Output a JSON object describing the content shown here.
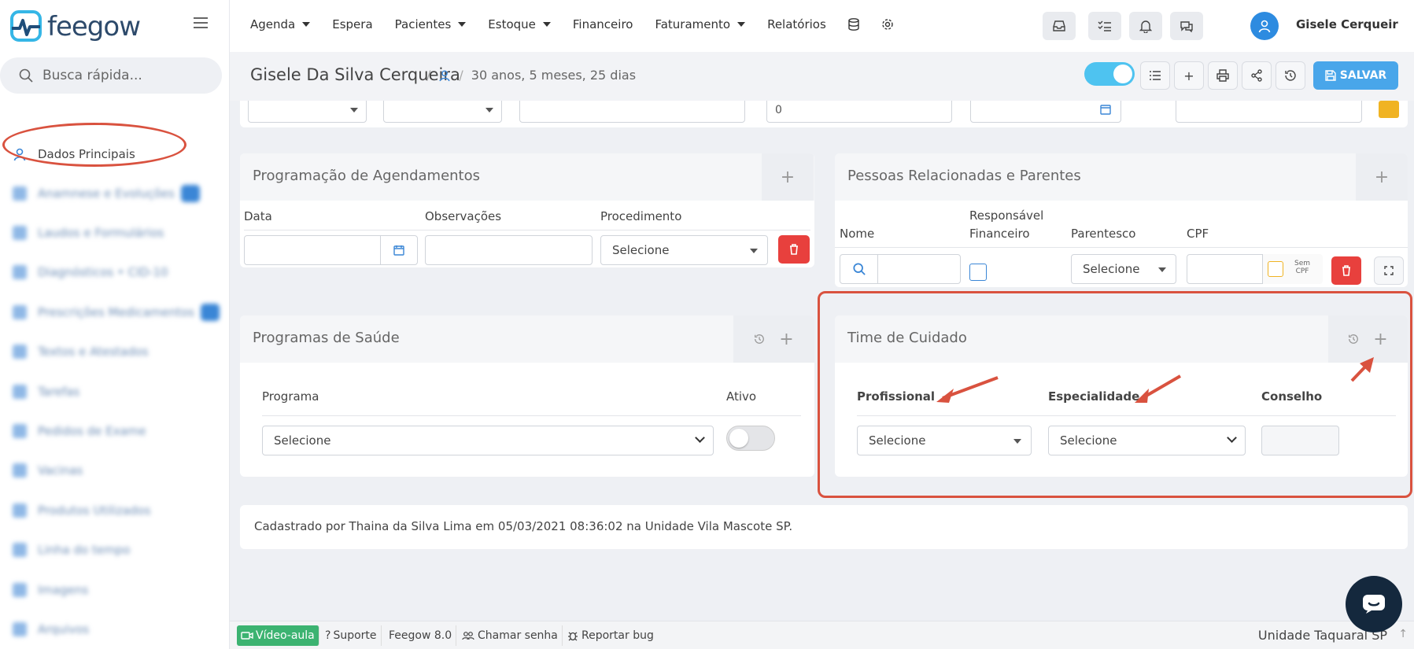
{
  "app": {
    "logo_text": "feegow"
  },
  "sidebar": {
    "search_placeholder": "Busca rápida...",
    "active_item": "Dados Principais",
    "blurred_items": [
      "Anamnese e Evoluções",
      "Laudos e Formulários",
      "Diagnósticos • CID-10",
      "Prescrições Medicamentos",
      "Textos e Atestados",
      "Tarefas",
      "Pedidos de Exame",
      "Vacinas",
      "Produtos Utilizados",
      "Linha do tempo",
      "Imagens",
      "Arquivos"
    ]
  },
  "topnav": {
    "items": [
      "Agenda",
      "Espera",
      "Pacientes",
      "Estoque",
      "Financeiro",
      "Faturamento",
      "Relatórios"
    ],
    "user_name": "Gisele Cerqueir"
  },
  "patient": {
    "name": "Gisele Da Silva Cerqueira",
    "age": "30 anos, 5 meses, 25 dias",
    "save_label": "SALVAR"
  },
  "top_row": {
    "number_value": "0"
  },
  "programacao": {
    "title": "Programação de Agendamentos",
    "col_data": "Data",
    "col_obs": "Observações",
    "col_proc": "Procedimento",
    "select_value": "Selecione"
  },
  "pessoas": {
    "title": "Pessoas Relacionadas e Parentes",
    "col_nome": "Nome",
    "col_resp_1": "Responsável",
    "col_resp_2": "Financeiro",
    "col_parentesco": "Parentesco",
    "col_cpf": "CPF",
    "select_value": "Selecione",
    "sem_cpf_1": "Sem",
    "sem_cpf_2": "CPF"
  },
  "programas": {
    "title": "Programas de Saúde",
    "col_programa": "Programa",
    "col_ativo": "Ativo",
    "select_value": "Selecione"
  },
  "time_cuidado": {
    "title": "Time de Cuidado",
    "col_prof": "Profissional",
    "col_esp": "Especialidade",
    "col_conselho": "Conselho",
    "prof_value": "Selecione",
    "esp_value": "Selecione"
  },
  "cadastro": {
    "text": "Cadastrado por Thaina da Silva Lima em 05/03/2021 08:36:02 na Unidade Vila Mascote SP."
  },
  "footer": {
    "video": "Vídeo-aula",
    "suporte": "Suporte",
    "version": "Feegow 8.0",
    "chamar": "Chamar senha",
    "reportar": "Reportar bug",
    "unidade": "Unidade Taquaral SP"
  },
  "colors": {
    "accent": "#49a6ea",
    "danger": "#e8403d",
    "annotation": "#d9523f"
  }
}
